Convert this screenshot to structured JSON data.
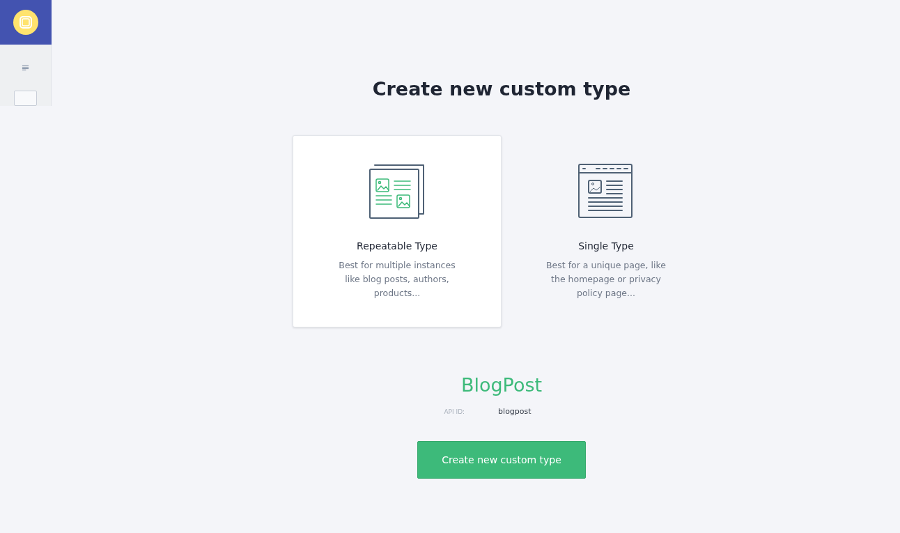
{
  "title": "Create new custom type",
  "types": [
    {
      "kind": "repeatable",
      "label": "Repeatable Type",
      "description": "Best for multiple instances like blog posts, authors, products...",
      "selected": true
    },
    {
      "kind": "single",
      "label": "Single Type",
      "description": "Best for a unique page, like the homepage or privacy policy page...",
      "selected": false
    }
  ],
  "name_field": {
    "value": "BlogPost"
  },
  "api_id": {
    "label": "API ID:",
    "value": "blogpost"
  },
  "submit_button": "Create new custom type"
}
